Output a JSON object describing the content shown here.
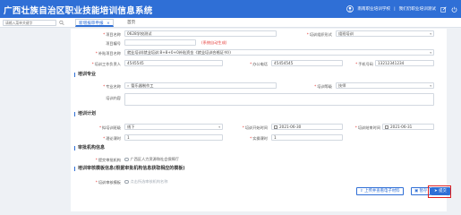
{
  "header": {
    "title": "广西壮族自治区职业技能培训信息系统",
    "user": "南南职业培训学校",
    "org_link": "我们仍职业培训测试",
    "icons": [
      "user-icon",
      "edit-icon",
      "power-icon"
    ]
  },
  "tabs": {
    "search_placeholder": "请输入菜单关键字",
    "items": [
      {
        "label": "新增报审申报"
      },
      {
        "label": "首页"
      }
    ]
  },
  "form": {
    "fields": {
      "project_name": {
        "label": "项目名称",
        "value": "0628学校测试"
      },
      "training_method": {
        "label": "培训组织形式",
        "value": "组班培训"
      },
      "project_no": {
        "label": "项目编号",
        "value": "",
        "note": "(系统自动生成)"
      },
      "subsidy": {
        "label": "补贴项目名称",
        "value": "就业培训(就业培训:8+8+0+0补贴资金《就业培训合格证书》)"
      },
      "contact": {
        "label": "培训工作负责人",
        "value": "4545545"
      },
      "office_phone": {
        "label": "办公电话",
        "value": "45454545"
      },
      "mobile": {
        "label": "手机号码",
        "value": "13212341234"
      }
    },
    "sections": {
      "major": "培训专业",
      "plan": "培训计划",
      "reviewer": "审批机构信息",
      "template": "培训审核模板信息(根据审批机构信息获取相应的模板)"
    },
    "major": {
      "name_label": "专业名称",
      "name_value": "管乐器制作工",
      "level_label": "培训等级",
      "level_value": "技师",
      "content_label": "培训内容",
      "content_value": ""
    },
    "plan": {
      "location_label": "拟培训班级",
      "location_value": "线下",
      "start_label": "培训开始时间",
      "start_value": "2021-06-30",
      "end_label": "培训结束时间",
      "end_value": "2021-06-31",
      "credits_label": "理论课时",
      "credits_value": "1",
      "practice_label": "实操课时",
      "practice_value": "1"
    },
    "reviewer": {
      "label": "提交审批机构",
      "value": "广西区人力资源和社会保障厅"
    },
    "template": {
      "label": "培训审核模板",
      "placeholder": "点击所选审核机构名称"
    }
  },
  "actions": {
    "upload_label": "上传并查看电子材料",
    "save_label": "暂存",
    "submit_label": "提交"
  }
}
